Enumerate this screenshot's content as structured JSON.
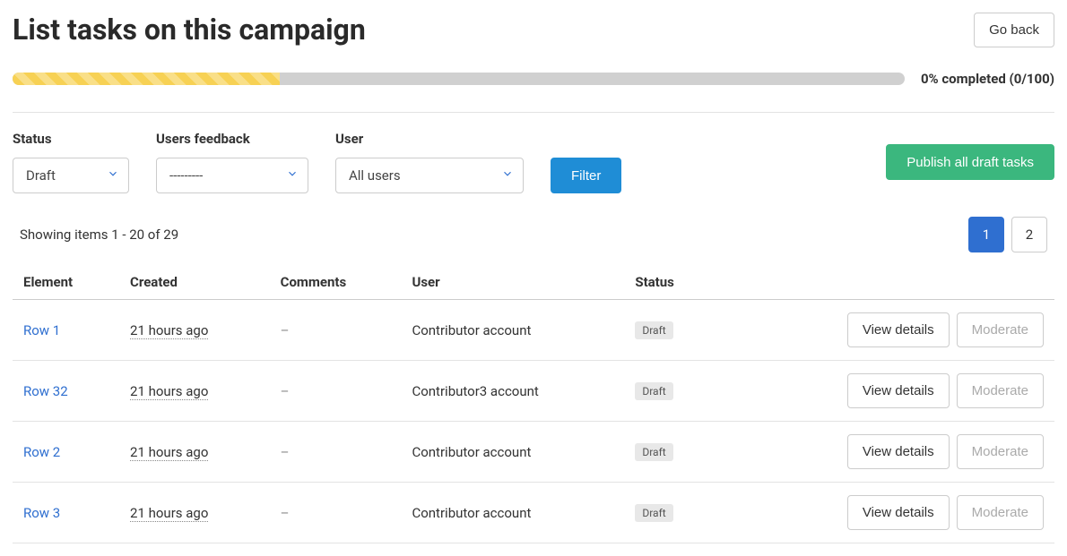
{
  "header": {
    "title": "List tasks on this campaign",
    "go_back": "Go back"
  },
  "progress": {
    "label": "0% completed (0/100)",
    "fill_percent": 30
  },
  "filters": {
    "status": {
      "label": "Status",
      "value": "Draft"
    },
    "feedback": {
      "label": "Users feedback",
      "value": "---------"
    },
    "user": {
      "label": "User",
      "value": "All users"
    },
    "filter_btn": "Filter",
    "publish_btn": "Publish all draft tasks"
  },
  "table": {
    "showing": "Showing items 1 - 20 of 29",
    "pages": [
      "1",
      "2"
    ],
    "active_page": "1",
    "columns": {
      "element": "Element",
      "created": "Created",
      "comments": "Comments",
      "user": "User",
      "status": "Status",
      "actions": ""
    },
    "view_details": "View details",
    "moderate": "Moderate",
    "dash": "–",
    "rows": [
      {
        "element": "Row 1",
        "created": "21 hours ago",
        "user": "Contributor account",
        "status": "Draft"
      },
      {
        "element": "Row 32",
        "created": "21 hours ago",
        "user": "Contributor3 account",
        "status": "Draft"
      },
      {
        "element": "Row 2",
        "created": "21 hours ago",
        "user": "Contributor account",
        "status": "Draft"
      },
      {
        "element": "Row 3",
        "created": "21 hours ago",
        "user": "Contributor account",
        "status": "Draft"
      }
    ]
  }
}
